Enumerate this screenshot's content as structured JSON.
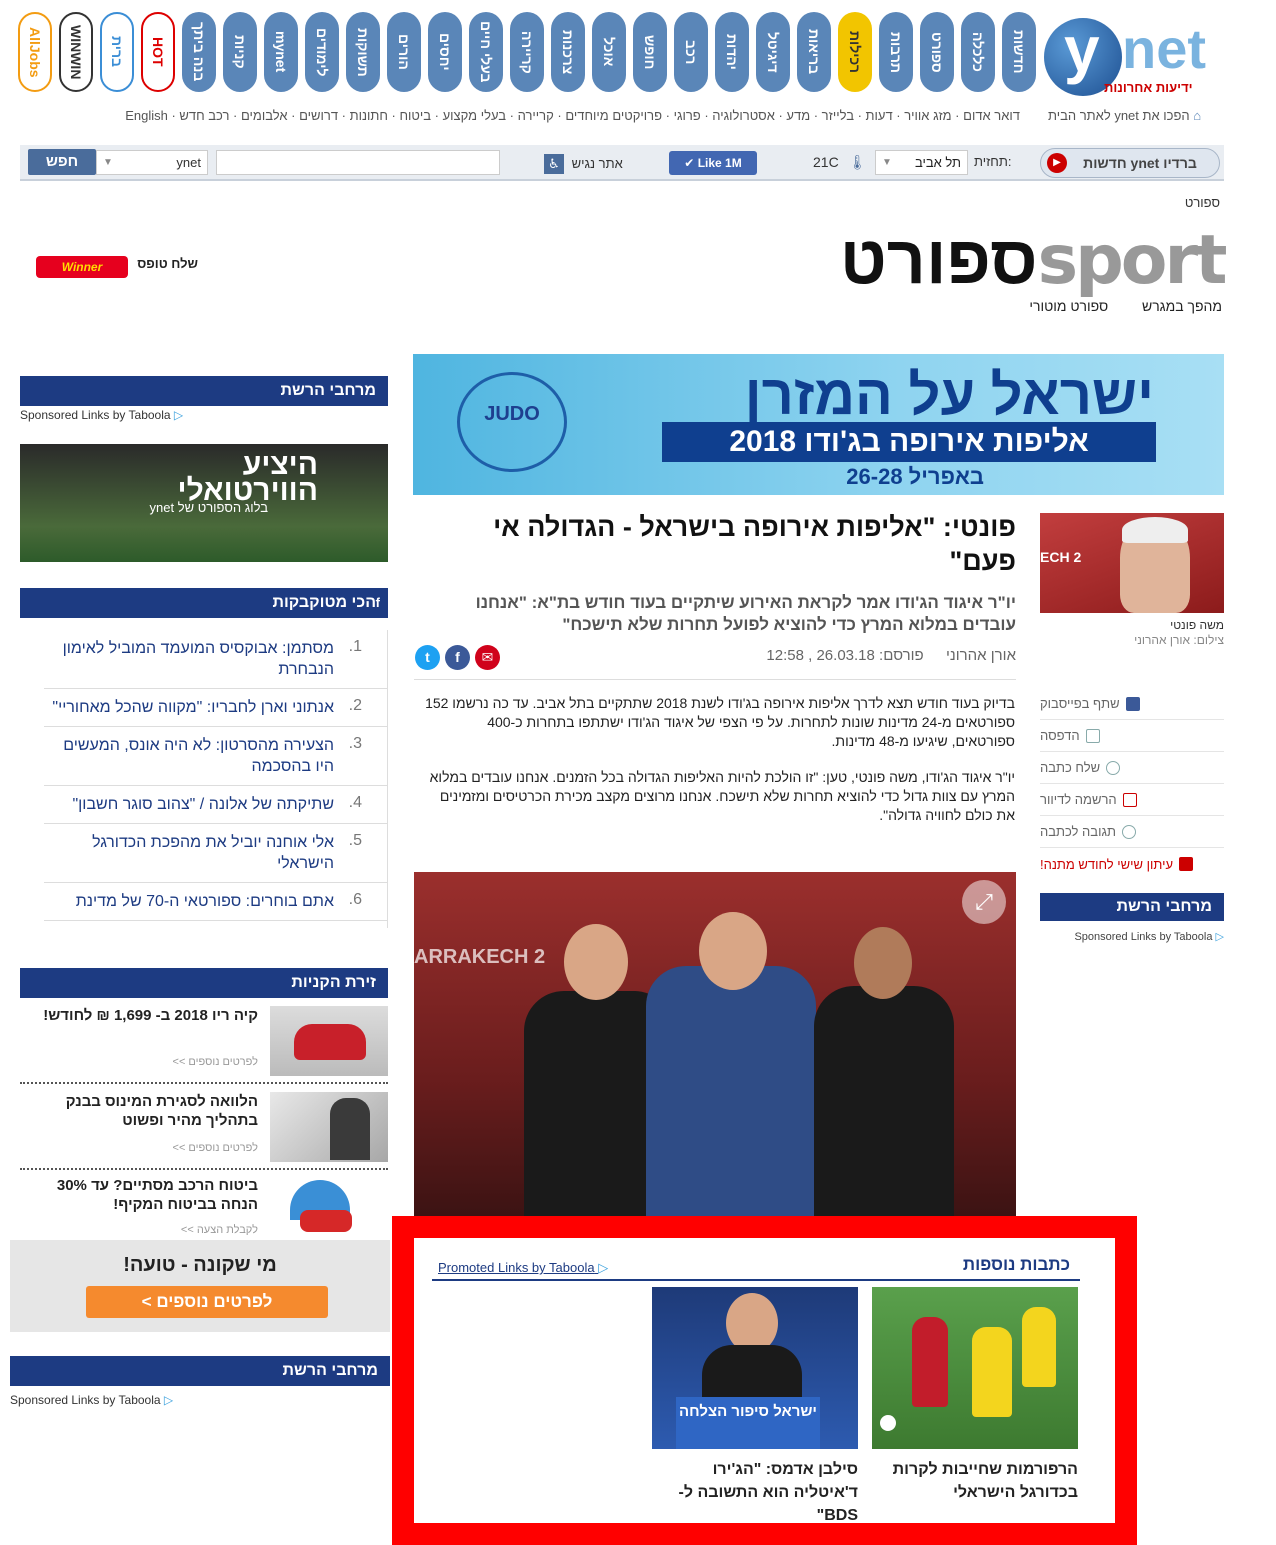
{
  "top_nav": {
    "sites": [
      "AllJobs",
      "WINWIN",
      "ברית",
      "HOT",
      "בנה ביתך",
      "קניות",
      "mynet",
      "לימודים",
      "תשוקות",
      "הורים",
      "יחסים",
      "בעלי חיים",
      "קריירה",
      "צרכנות",
      "אוכל",
      "חופש",
      "רכב",
      "יהדות",
      "דיגיטל",
      "בריאות",
      "רכילות",
      "תרבות",
      "ספורט",
      "כלכלה",
      "חדשות"
    ],
    "logo_text": "ynet",
    "logo_sub": "ידיעות אחרונות",
    "home_link": "הפכו את ynet לאתר הבית",
    "sub_links": "דואר אדום · מזג אוויר · דעות · בלייזר · מדע · אסטרולוגיה · פרוגי · פרויקטים מיוחדים · קריירה · בעלי מקצוע · ביטוח · חתונות · דרושים · אלבומים · רכב חדש · English"
  },
  "toolbar": {
    "search_button": "חפש",
    "search_scope": "ynet",
    "accessibility": "אתר נגיש",
    "like": "Like 1M",
    "temperature": "21C",
    "city": "תל אביב",
    "forecast_label": "תחזית:",
    "radio": "חדשות ynet ברדיו"
  },
  "breadcrumb": "ספורט",
  "section": {
    "logo_en": "sport",
    "logo_he": "ספורט",
    "sub_links": [
      "מהפך במגרש",
      "ספורט מוטורי"
    ],
    "winner_label": "שלח טופס",
    "winner_brand": "Winner"
  },
  "banner": {
    "line1": "ישראל על המזרן",
    "line2": "אליפות אירופה בג'ודו 2018",
    "line3": "26-28 באפריל",
    "judo_logo": "JUDO"
  },
  "article": {
    "headline": "פונטי: \"אליפות אירופה בישראל - הגדולה אי פעם\"",
    "subtitle": "יו\"ר איגוד הג'ודו אמר לקראת האירוע שיתקיים בעוד חודש בת\"א: \"אנחנו עובדים במלוא המרץ כדי להוציא לפועל תחרות שלא תישכח\"",
    "author": "אורן אהרוני",
    "published_label": "פורסם:",
    "published": "26.03.18 , 12:58",
    "body1": "בדיוק בעוד חודש תצא לדרך אליפות אירופה בג'ודו לשנת 2018 שתתקיים בתל אביב. עד כה נרשמו 152 ספורטאים מ-24 מדינות שונות לתחרות. על פי הצפי של איגוד הג'ודו ישתתפו בתחרות כ-400 ספורטאים, שיגיעו מ-48 מדינות.",
    "body2": "יו\"ר איגוד הג'ודו, משה פונטי, טען: \"זו הולכת להיות האליפות הגדולה בכל הזמנים. אנחנו עובדים במלוא המרץ עם צוות גדול כדי להוציא תחרות שלא תישכח. אנחנו מרוצים מקצב מכירת הכרטיסים ומזמינים את כולם לחוויה גדולה\"."
  },
  "author_box": {
    "caption": "משה פונטי",
    "photo_credit": "צילום: אורן אהרוני",
    "links": [
      "שתף בפייסבוק",
      "הדפסה",
      "שלח כתבה",
      "הרשמה לדיוור",
      "תגובה לכתבה",
      "עיתון שישי לחודש מתנה!"
    ]
  },
  "right_rail": {
    "block_title": "מרחבי הרשת",
    "taboola": "Sponsored Links by Taboola"
  },
  "left_column": {
    "block1_title": "מרחבי הרשת",
    "taboola": "Sponsored Links by Taboola",
    "virtual": {
      "l1": "היציע",
      "l2": "הווירטואלי",
      "l3": "בלוג הספורט של ynet"
    },
    "top_reads_title": "הכי מטוקבקות",
    "top_reads": [
      {
        "n": "1.",
        "t": "מסתמן: אבוקסיס המועמד המוביל לאימון הנבחרת"
      },
      {
        "n": "2.",
        "t": "אנתוני וארן לחבריו: \"מקווה שהכל מאחוריי\""
      },
      {
        "n": "3.",
        "t": "הצעירה מהסרטון: לא היה אונס, המעשים היו בהסכמה"
      },
      {
        "n": "4.",
        "t": "שתיקתה של אלונה / \"צהוב סוגר חשבון\""
      },
      {
        "n": "5.",
        "t": "אלי אוחנה יוביל את מהפכת הכדורגל הישראלי"
      },
      {
        "n": "6.",
        "t": "אתם בוחרים: ספורטאי ה-70 של מדינת"
      }
    ],
    "shop_title": "זירת הקניות",
    "shop_items": [
      {
        "t": "קיה ריו 2018 ב- 1,699 ₪ לחודש!",
        "more": "לפרטים נוספים >>"
      },
      {
        "t": "הלוואה לסגירת המינוס בבנק בתהליך מהיר ופשוט",
        "more": "לפרטים נוספים >>"
      },
      {
        "t": "ביטוח הרכב מסתיים? עד 30% הנחה בביטוח המקיף!",
        "more": "לקבלת הצעה >>"
      }
    ],
    "mishakuna_q": "מי שקונה - טועה!",
    "mishakuna_btn": "לפרטים נוספים >",
    "block2_title": "מרחבי הרשת",
    "taboola2": "Sponsored Links by Taboola"
  },
  "more_articles": {
    "title": "כתבות נוספות",
    "promoted": "Promoted Links by Taboola",
    "cards": [
      {
        "title": "הרפורמות שחייבות לקרות בכדורגל הישראלי"
      },
      {
        "title": "סילבן אדמס: \"הג'ירו ד'איטליה הוא התשובה ל-BDS\"",
        "img_text": "ישראל סיפור הצלחה"
      }
    ]
  },
  "colors": {
    "brand_blue": "#1d3b82",
    "highlight_red": "#ff0000"
  }
}
